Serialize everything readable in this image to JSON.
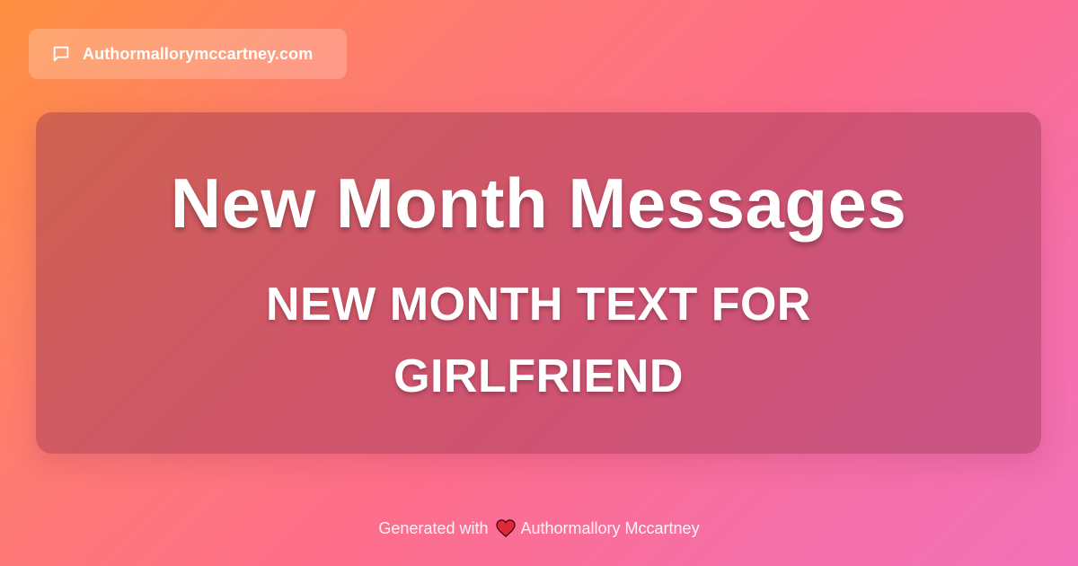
{
  "site_badge": {
    "icon": "chat-bubble-icon",
    "label": "Authormallorymccartney.com"
  },
  "card": {
    "headline": "New Month Messages",
    "subheadline": "NEW MONTH TEXT FOR GIRLFRIEND"
  },
  "footer": {
    "prefix": "Generated with",
    "icon": "heart-icon",
    "author": "Authormallory Mccartney"
  },
  "colors": {
    "gradient_start": "#ff9040",
    "gradient_end": "#f270b6",
    "heart": "#e0263a",
    "text": "#ffffff"
  }
}
